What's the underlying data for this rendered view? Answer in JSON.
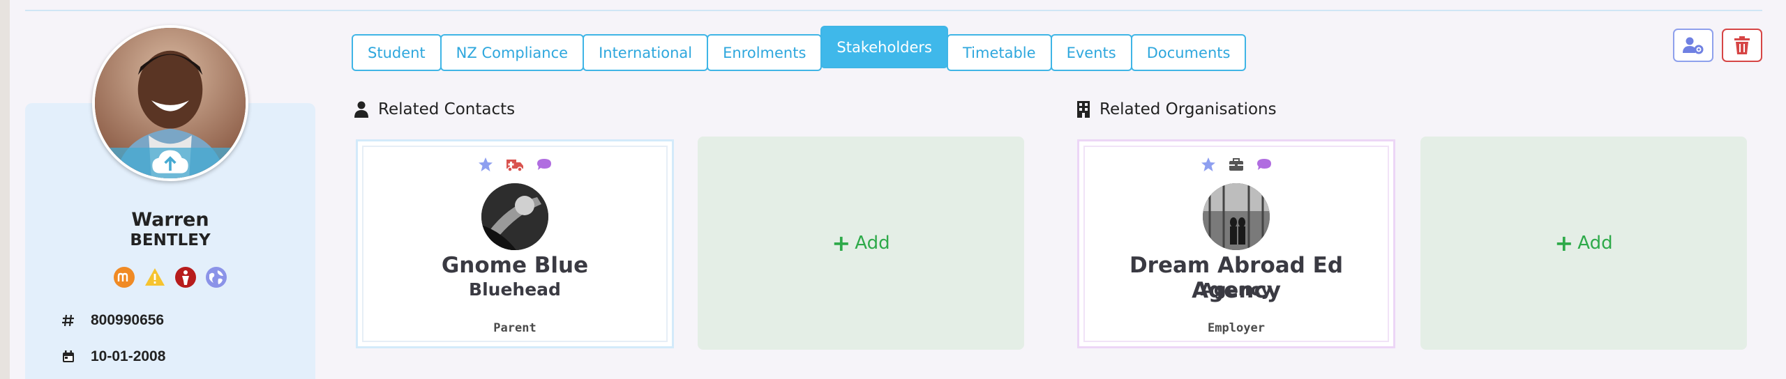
{
  "tabs": [
    {
      "label": "Student",
      "active": false
    },
    {
      "label": "NZ Compliance",
      "active": false
    },
    {
      "label": "International",
      "active": false
    },
    {
      "label": "Enrolments",
      "active": false
    },
    {
      "label": "Stakeholders",
      "active": true
    },
    {
      "label": "Timetable",
      "active": false
    },
    {
      "label": "Events",
      "active": false
    },
    {
      "label": "Documents",
      "active": false
    }
  ],
  "actions": {
    "settings_icon": "user-settings-icon",
    "delete_icon": "trash-icon"
  },
  "profile": {
    "first_name": "Warren",
    "last_name": "BENTLEY",
    "status_icons": [
      "moodle-icon",
      "warning-icon",
      "student-icon",
      "globe-icon"
    ],
    "id_number": "800990656",
    "date_of_birth": "10-01-2008"
  },
  "related_contacts": {
    "heading": "Related Contacts",
    "card": {
      "icons": [
        "star-icon",
        "ambulance-icon",
        "chat-icon"
      ],
      "name": "Gnome Blue",
      "subname": "Bluehead",
      "role": "Parent"
    },
    "add_label": "Add"
  },
  "related_organisations": {
    "heading": "Related Organisations",
    "card": {
      "icons": [
        "star-icon",
        "briefcase-icon",
        "chat-icon"
      ],
      "name": "Dream Abroad Ed Agency",
      "subname": "Agency",
      "role": "Employer"
    },
    "add_label": "Add"
  },
  "colors": {
    "accent": "#3fb8ea",
    "add_green": "#2eaa4a",
    "delete_red": "#d64545"
  }
}
